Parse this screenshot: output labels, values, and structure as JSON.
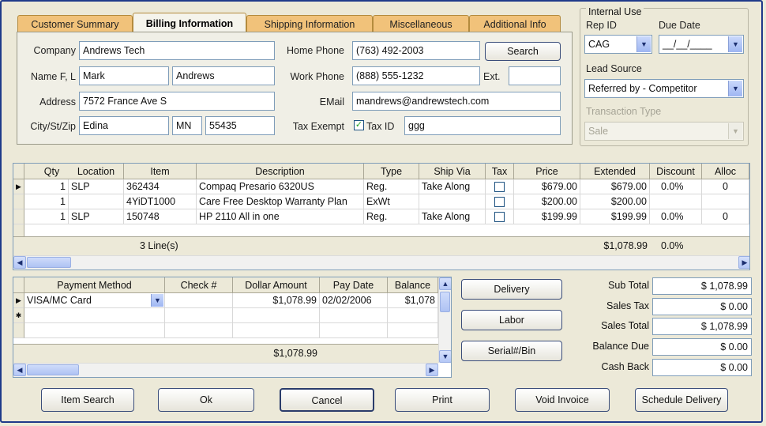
{
  "tabs": [
    "Customer Summary",
    "Billing Information",
    "Shipping Information",
    "Miscellaneous",
    "Additional Info"
  ],
  "billing": {
    "company_label": "Company",
    "company": "Andrews Tech",
    "name_label": "Name F, L",
    "first_name": "Mark",
    "last_name": "Andrews",
    "address_label": "Address",
    "address": "7572 France Ave S",
    "city_label": "City/St/Zip",
    "city": "Edina",
    "state": "MN",
    "zip": "55435",
    "home_phone_label": "Home Phone",
    "home_phone": "(763) 492-2003",
    "work_phone_label": "Work Phone",
    "work_phone": "(888) 555-1232",
    "ext_label": "Ext.",
    "ext": "",
    "email_label": "EMail",
    "email": "mandrews@andrewstech.com",
    "tax_exempt_label": "Tax Exempt",
    "tax_id_label": "Tax ID",
    "tax_id": "ggg",
    "search_label": "Search"
  },
  "internal": {
    "title": "Internal Use",
    "rep_id_label": "Rep ID",
    "rep_id": "CAG",
    "due_date_label": "Due Date",
    "due_date": "__/__/____",
    "lead_source_label": "Lead Source",
    "lead_source": "Referred by - Competitor",
    "transaction_type_label": "Transaction Type",
    "transaction_type": "Sale"
  },
  "items": {
    "columns": [
      "Qty",
      "Location",
      "Item",
      "Description",
      "Type",
      "Ship Via",
      "Tax",
      "Price",
      "Extended",
      "Discount",
      "Alloc"
    ],
    "rows": [
      [
        "1",
        "SLP",
        "362434",
        "Compaq Presario 6320US",
        "Reg.",
        "Take Along",
        "",
        "$679.00",
        "$679.00",
        "0.0%",
        "0"
      ],
      [
        "1",
        "",
        "4YiDT1000",
        "Care Free Desktop Warranty Plan",
        "ExWt",
        "",
        "",
        "$200.00",
        "$200.00",
        "",
        ""
      ],
      [
        "1",
        "SLP",
        "150748",
        "HP 2110 All in one",
        "Reg.",
        "Take Along",
        "",
        "$199.99",
        "$199.99",
        "0.0%",
        "0"
      ]
    ],
    "lines_summary": "3 Line(s)",
    "total_extended": "$1,078.99",
    "total_discount": "0.0%"
  },
  "payments": {
    "columns": [
      "Payment Method",
      "Check #",
      "Dollar Amount",
      "Pay Date",
      "Balance"
    ],
    "rows": [
      [
        "VISA/MC Card",
        "",
        "$1,078.99",
        "02/02/2006",
        "$1,078"
      ]
    ],
    "total": "$1,078.99"
  },
  "side_buttons": [
    "Delivery",
    "Labor",
    "Serial#/Bin"
  ],
  "summary": [
    {
      "label": "Sub Total",
      "value": "$ 1,078.99"
    },
    {
      "label": "Sales Tax",
      "value": "$ 0.00"
    },
    {
      "label": "Sales Total",
      "value": "$ 1,078.99"
    },
    {
      "label": "Balance Due",
      "value": "$ 0.00"
    },
    {
      "label": "Cash Back",
      "value": "$ 0.00"
    }
  ],
  "bottom_buttons": [
    "Item Search",
    "Ok",
    "Cancel",
    "Print",
    "Void Invoice",
    "Schedule Delivery"
  ]
}
